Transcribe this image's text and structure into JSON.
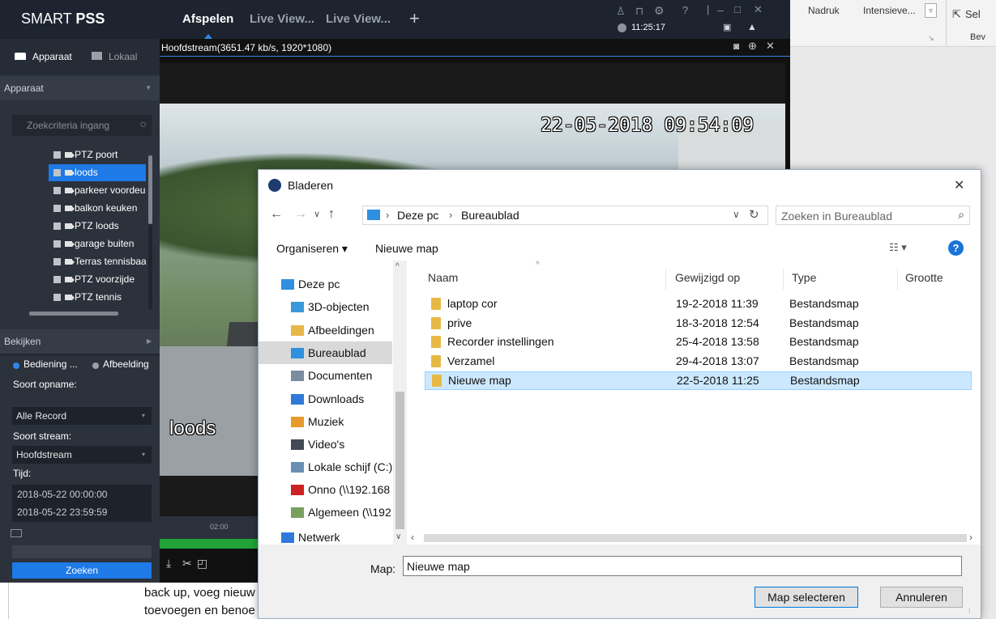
{
  "app": {
    "name_prefix": "SMART ",
    "name_strong": "PSS",
    "tabs": [
      "Afspelen",
      "Live View...",
      "Live View..."
    ],
    "add_tab": "+",
    "clock": "11:25:17"
  },
  "sidebar": {
    "tab_device": "Apparaat",
    "tab_local": "Lokaal",
    "section_device": "Apparaat",
    "search_placeholder": "Zoekcriteria ingang",
    "devices": [
      "PTZ poort",
      "loods",
      "parkeer voordeur",
      "balkon keuken",
      "PTZ loods",
      "garage buiten",
      "Terras tennisbaan",
      "PTZ voorzijde",
      "PTZ tennis"
    ],
    "section_view": "Bekijken",
    "radio_operation": "Bediening ...",
    "radio_image": "Afbeelding",
    "record_type_label": "Soort opname:",
    "record_type_value": "Alle Record",
    "stream_type_label": "Soort stream:",
    "stream_type_value": "Hoofdstream",
    "time_label": "Tijd:",
    "time_start": "2018-05-22 00:00:00",
    "time_end": "2018-05-22 23:59:59",
    "search_button": "Zoeken"
  },
  "video": {
    "stream_info": "Hoofdstream(3651.47 kb/s, 1920*1080)",
    "timestamp": "22-05-2018 09:54:09",
    "camera_label": "loods",
    "timeline_tick": "02:00"
  },
  "word": {
    "ribbon_nadruk": "Nadruk",
    "ribbon_intensieve": "Intensieve...",
    "ribbon_select": "Sel",
    "ribbon_bew": "Bev",
    "doc_line1": "back up, voeg nieuw",
    "doc_line2": "toevoegen en benoe"
  },
  "dialog": {
    "title": "Bladeren",
    "breadcrumb": [
      "Deze pc",
      "Bureaublad"
    ],
    "search_placeholder": "Zoeken in Bureaublad",
    "organize": "Organiseren",
    "new_folder": "Nieuwe map",
    "help": "?",
    "nav": [
      {
        "label": "Deze pc",
        "color": "#2f8fe0"
      },
      {
        "label": "3D-objecten",
        "color": "#3a9ad9"
      },
      {
        "label": "Afbeeldingen",
        "color": "#e5b847"
      },
      {
        "label": "Bureaublad",
        "color": "#2f8fe0"
      },
      {
        "label": "Documenten",
        "color": "#7a8ca0"
      },
      {
        "label": "Downloads",
        "color": "#2f7ad9"
      },
      {
        "label": "Muziek",
        "color": "#e69a2e"
      },
      {
        "label": "Video's",
        "color": "#444a55"
      },
      {
        "label": "Lokale schijf (C:)",
        "color": "#6a8fb5"
      },
      {
        "label": "Onno (\\\\192.168",
        "color": "#cc2222"
      },
      {
        "label": "Algemeen (\\\\192",
        "color": "#7aa060"
      },
      {
        "label": "Netwerk",
        "color": "#2f7ad9"
      }
    ],
    "columns": [
      "Naam",
      "Gewijzigd op",
      "Type",
      "Grootte"
    ],
    "files": [
      {
        "name": "laptop cor",
        "modified": "19-2-2018 11:39",
        "type": "Bestandsmap"
      },
      {
        "name": "prive",
        "modified": "18-3-2018 12:54",
        "type": "Bestandsmap"
      },
      {
        "name": "Recorder instellingen",
        "modified": "25-4-2018 13:58",
        "type": "Bestandsmap"
      },
      {
        "name": "Verzamel",
        "modified": "29-4-2018 13:07",
        "type": "Bestandsmap"
      },
      {
        "name": "Nieuwe map",
        "modified": "22-5-2018 11:25",
        "type": "Bestandsmap"
      }
    ],
    "folder_label": "Map:",
    "folder_value": "Nieuwe map",
    "select_button": "Map selecteren",
    "cancel_button": "Annuleren"
  }
}
